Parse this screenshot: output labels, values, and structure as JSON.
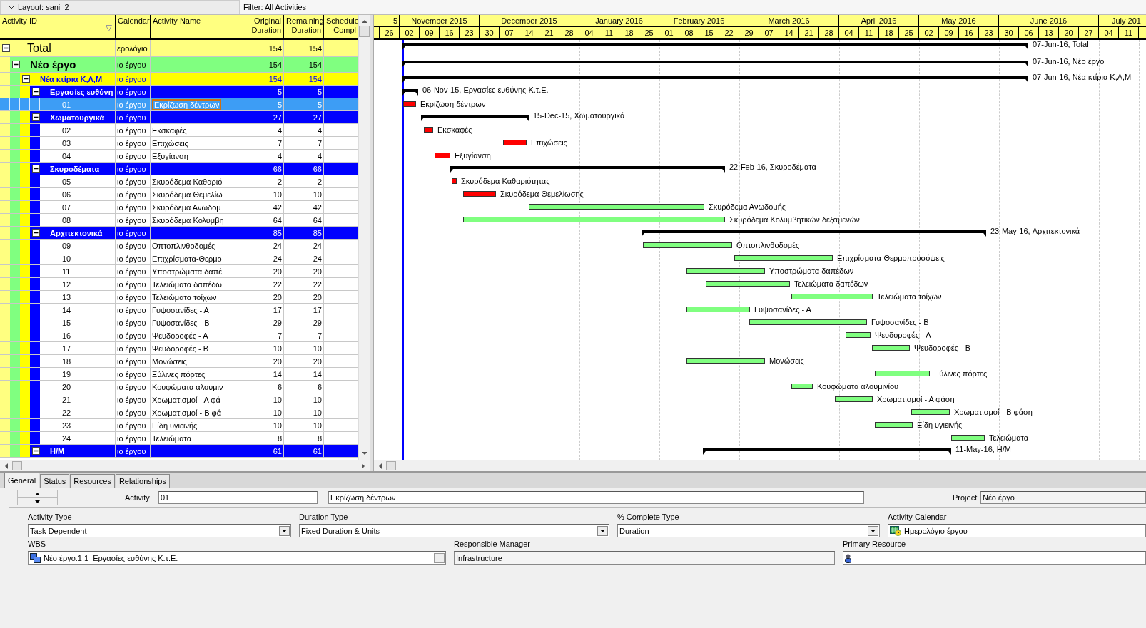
{
  "layout_bar": {
    "layout": "Layout: sani_2",
    "filter": "Filter: All Activities"
  },
  "table": {
    "columns": [
      "Activity ID",
      "Calendar",
      "Activity Name",
      "Original Duration",
      "Remaining Duration",
      "Schedule Compl"
    ],
    "rows": [
      {
        "id": "Total",
        "calendar": "ερολόγιο",
        "name": "",
        "original_duration": "154",
        "remaining_duration": "154",
        "bar_label": "07-Jun-16, Total",
        "selected": false,
        "expanded": true,
        "children": [
          {
            "id": "Νέο έργο",
            "calendar": "ιο έργου",
            "original_duration": "154",
            "remaining_duration": "154",
            "bar_label": "07-Jun-16, Νέο έργο",
            "selected": false,
            "expanded": true,
            "children": [
              {
                "id": "Νέα κτίρια Κ,Λ,Μ",
                "calendar": "ιο έργου",
                "original_duration": "154",
                "remaining_duration": "154",
                "bar_label": "07-Jun-16, Νέα κτίρια Κ,Λ,Μ",
                "selected": false,
                "expanded": true,
                "children": [
                  {
                    "id": "Εργασίες ευθύνη",
                    "calendar": "ιο έργου",
                    "original_duration": "5",
                    "remaining_duration": "5",
                    "bar_label": "06-Nov-15, Εργασίες ευθύνης Κ.τ.Ε.",
                    "selected": false,
                    "expanded": true,
                    "children": [
                      {
                        "id": "01",
                        "calendar": "ιο έργου",
                        "name": "Εκρίζωση δέντρων",
                        "original_duration": "5",
                        "remaining_duration": "5",
                        "bar_label": "Εκρίζωση δέντρων",
                        "critical": true,
                        "selected": true
                      }
                    ]
                  },
                  {
                    "id": "Χωματουργικά",
                    "calendar": "ιο έργου",
                    "original_duration": "27",
                    "remaining_duration": "27",
                    "bar_label": "15-Dec-15, Χωματουργικά",
                    "selected": false,
                    "expanded": true,
                    "children": [
                      {
                        "id": "02",
                        "calendar": "ιο έργου",
                        "name": "Εκσκαφές",
                        "original_duration": "4",
                        "remaining_duration": "4",
                        "bar_label": "Εκσκαφές",
                        "critical": true,
                        "selected": false
                      },
                      {
                        "id": "03",
                        "calendar": "ιο έργου",
                        "name": "Επιχώσεις",
                        "original_duration": "7",
                        "remaining_duration": "7",
                        "bar_label": "Επιχώσεις",
                        "critical": true,
                        "selected": false
                      },
                      {
                        "id": "04",
                        "calendar": "ιο έργου",
                        "name": "Εξυγίανση",
                        "original_duration": "4",
                        "remaining_duration": "4",
                        "bar_label": "Εξυγίανση",
                        "critical": true,
                        "selected": false
                      }
                    ]
                  },
                  {
                    "id": "Σκυροδέματα",
                    "calendar": "ιο έργου",
                    "original_duration": "66",
                    "remaining_duration": "66",
                    "bar_label": "22-Feb-16, Σκυροδέματα",
                    "selected": false,
                    "expanded": true,
                    "children": [
                      {
                        "id": "05",
                        "calendar": "ιο έργου",
                        "name": "Σκυρόδεμα Καθαριό",
                        "original_duration": "2",
                        "remaining_duration": "2",
                        "bar_label": "Σκυρόδεμα Καθαριότητας",
                        "critical": true,
                        "selected": false
                      },
                      {
                        "id": "06",
                        "calendar": "ιο έργου",
                        "name": "Σκυρόδεμα Θεμελίω",
                        "original_duration": "10",
                        "remaining_duration": "10",
                        "bar_label": "Σκυρόδεμα Θεμελίωσης",
                        "critical": true,
                        "selected": false
                      },
                      {
                        "id": "07",
                        "calendar": "ιο έργου",
                        "name": "Σκυρόδεμα Ανωδομ",
                        "original_duration": "42",
                        "remaining_duration": "42",
                        "bar_label": "Σκυρόδεμα Ανωδομής",
                        "critical": false,
                        "selected": false
                      },
                      {
                        "id": "08",
                        "calendar": "ιο έργου",
                        "name": "Σκυρόδεμα Κολυμβη",
                        "original_duration": "64",
                        "remaining_duration": "64",
                        "bar_label": "Σκυρόδεμα Κολυμβητικών δεξαμενών",
                        "critical": false,
                        "selected": false
                      }
                    ]
                  },
                  {
                    "id": "Αρχιτεκτονικά",
                    "calendar": "ιο έργου",
                    "original_duration": "85",
                    "remaining_duration": "85",
                    "bar_label": "23-May-16, Αρχιτεκτονικά",
                    "selected": false,
                    "expanded": true,
                    "children": [
                      {
                        "id": "09",
                        "calendar": "ιο έργου",
                        "name": "Οπτοπλινθοδομές",
                        "original_duration": "24",
                        "remaining_duration": "24",
                        "bar_label": "Οπτοπλινθοδομές",
                        "critical": false,
                        "selected": false
                      },
                      {
                        "id": "10",
                        "calendar": "ιο έργου",
                        "name": "Επιχρίσματα-Θερμο",
                        "original_duration": "24",
                        "remaining_duration": "24",
                        "bar_label": "Επιχρίσματα-Θερμοπροσόψεις",
                        "critical": false,
                        "selected": false
                      },
                      {
                        "id": "11",
                        "calendar": "ιο έργου",
                        "name": "Υποστρώματα δαπέ",
                        "original_duration": "20",
                        "remaining_duration": "20",
                        "bar_label": "Υποστρώματα δαπέδων",
                        "critical": false,
                        "selected": false
                      },
                      {
                        "id": "12",
                        "calendar": "ιο έργου",
                        "name": "Τελειώματα δαπέδω",
                        "original_duration": "22",
                        "remaining_duration": "22",
                        "bar_label": "Τελειώματα δαπέδων",
                        "critical": false,
                        "selected": false
                      },
                      {
                        "id": "13",
                        "calendar": "ιο έργου",
                        "name": "Τελειώματα τοίχων",
                        "original_duration": "20",
                        "remaining_duration": "20",
                        "bar_label": "Τελειώματα τοίχων",
                        "critical": false,
                        "selected": false
                      },
                      {
                        "id": "14",
                        "calendar": "ιο έργου",
                        "name": "Γυψοσανίδες - Α",
                        "original_duration": "17",
                        "remaining_duration": "17",
                        "bar_label": "Γυψοσανίδες - Α",
                        "critical": false,
                        "selected": false
                      },
                      {
                        "id": "15",
                        "calendar": "ιο έργου",
                        "name": "Γυψοσανίδες - Β",
                        "original_duration": "29",
                        "remaining_duration": "29",
                        "bar_label": "Γυψοσανίδες - Β",
                        "critical": false,
                        "selected": false
                      },
                      {
                        "id": "16",
                        "calendar": "ιο έργου",
                        "name": "Ψευδοροφές - Α",
                        "original_duration": "7",
                        "remaining_duration": "7",
                        "bar_label": "Ψευδοροφές - Α",
                        "critical": false,
                        "selected": false
                      },
                      {
                        "id": "17",
                        "calendar": "ιο έργου",
                        "name": "Ψευδοροφές - Β",
                        "original_duration": "10",
                        "remaining_duration": "10",
                        "bar_label": "Ψευδοροφές - Β",
                        "critical": false,
                        "selected": false
                      },
                      {
                        "id": "18",
                        "calendar": "ιο έργου",
                        "name": "Μονώσεις",
                        "original_duration": "20",
                        "remaining_duration": "20",
                        "bar_label": "Μονώσεις",
                        "critical": false,
                        "selected": false
                      },
                      {
                        "id": "19",
                        "calendar": "ιο έργου",
                        "name": "Ξύλινες πόρτες",
                        "original_duration": "14",
                        "remaining_duration": "14",
                        "bar_label": "Ξύλινες πόρτες",
                        "critical": false,
                        "selected": false
                      },
                      {
                        "id": "20",
                        "calendar": "ιο έργου",
                        "name": "Κουφώματα αλουμιν",
                        "original_duration": "6",
                        "remaining_duration": "6",
                        "bar_label": "Κουφώματα αλουμινίου",
                        "critical": false,
                        "selected": false
                      },
                      {
                        "id": "21",
                        "calendar": "ιο έργου",
                        "name": "Χρωματισμοί - Α φά",
                        "original_duration": "10",
                        "remaining_duration": "10",
                        "bar_label": "Χρωματισμοί - Α φάση",
                        "critical": false,
                        "selected": false
                      },
                      {
                        "id": "22",
                        "calendar": "ιο έργου",
                        "name": "Χρωματισμοί - Β φά",
                        "original_duration": "10",
                        "remaining_duration": "10",
                        "bar_label": "Χρωματισμοί - Β φάση",
                        "critical": false,
                        "selected": false
                      },
                      {
                        "id": "23",
                        "calendar": "ιο έργου",
                        "name": "Είδη υγιεινής",
                        "original_duration": "10",
                        "remaining_duration": "10",
                        "bar_label": "Είδη υγιεινής",
                        "critical": false,
                        "selected": false
                      },
                      {
                        "id": "24",
                        "calendar": "ιο έργου",
                        "name": "Τελειώματα",
                        "original_duration": "8",
                        "remaining_duration": "8",
                        "bar_label": "Τελειώματα",
                        "critical": false,
                        "selected": false
                      }
                    ]
                  },
                  {
                    "id": "H/M",
                    "calendar": "ιο έργου",
                    "original_duration": "61",
                    "remaining_duration": "61",
                    "bar_label": "11-May-16, H/M",
                    "selected": false,
                    "expanded": true
                  }
                ]
              }
            ]
          }
        ]
      }
    ]
  },
  "timescale": [
    {
      "label": "5",
      "weeks": [
        "26"
      ]
    },
    {
      "label": "November 2015",
      "weeks": [
        "02",
        "09",
        "16",
        "23"
      ]
    },
    {
      "label": "December 2015",
      "weeks": [
        "30",
        "07",
        "14",
        "21",
        "28"
      ]
    },
    {
      "label": "January 2016",
      "weeks": [
        "04",
        "11",
        "18",
        "25"
      ]
    },
    {
      "label": "February 2016",
      "weeks": [
        "01",
        "08",
        "15",
        "22"
      ]
    },
    {
      "label": "March 2016",
      "weeks": [
        "29",
        "07",
        "14",
        "21",
        "28"
      ]
    },
    {
      "label": "April 2016",
      "weeks": [
        "04",
        "11",
        "18",
        "25"
      ]
    },
    {
      "label": "May 2016",
      "weeks": [
        "02",
        "09",
        "16",
        "23"
      ]
    },
    {
      "label": "June 2016",
      "weeks": [
        "30",
        "06",
        "13",
        "20",
        "27"
      ]
    },
    {
      "label": "July 201",
      "weeks": [
        "04",
        "11"
      ]
    }
  ],
  "details": {
    "tabs": [
      {
        "label": "General",
        "selected": true
      },
      {
        "label": "Status",
        "selected": false
      },
      {
        "label": "Resources",
        "selected": false
      },
      {
        "label": "Relationships",
        "selected": false
      }
    ],
    "activity_label": "Activity",
    "activity_id": "01",
    "activity_name": "Εκρίζωση δέντρων",
    "project_label": "Project",
    "project": "Νέο έργο",
    "field_rows": [
      [
        {
          "label": "Activity Type",
          "value": "Task Dependent",
          "kind": "dropdown"
        },
        {
          "label": "Duration Type",
          "value": "Fixed Duration & Units",
          "kind": "dropdown"
        },
        {
          "label": "% Complete Type",
          "value": "Duration",
          "kind": "dropdown"
        },
        {
          "label": "Activity Calendar",
          "value": "Ημερολόγιο έργου",
          "kind": "calendar"
        }
      ],
      [
        {
          "label": "WBS",
          "value": "Νέο έργο.1.1  Εργασίες ευθύνης Κ.τ.Ε.",
          "kind": "wbs",
          "button": "..."
        },
        {
          "label": "Responsible Manager",
          "value": "Infrastructure",
          "kind": "readonly"
        },
        {
          "label": "Primary Resource",
          "kind": "resource"
        }
      ]
    ]
  }
}
